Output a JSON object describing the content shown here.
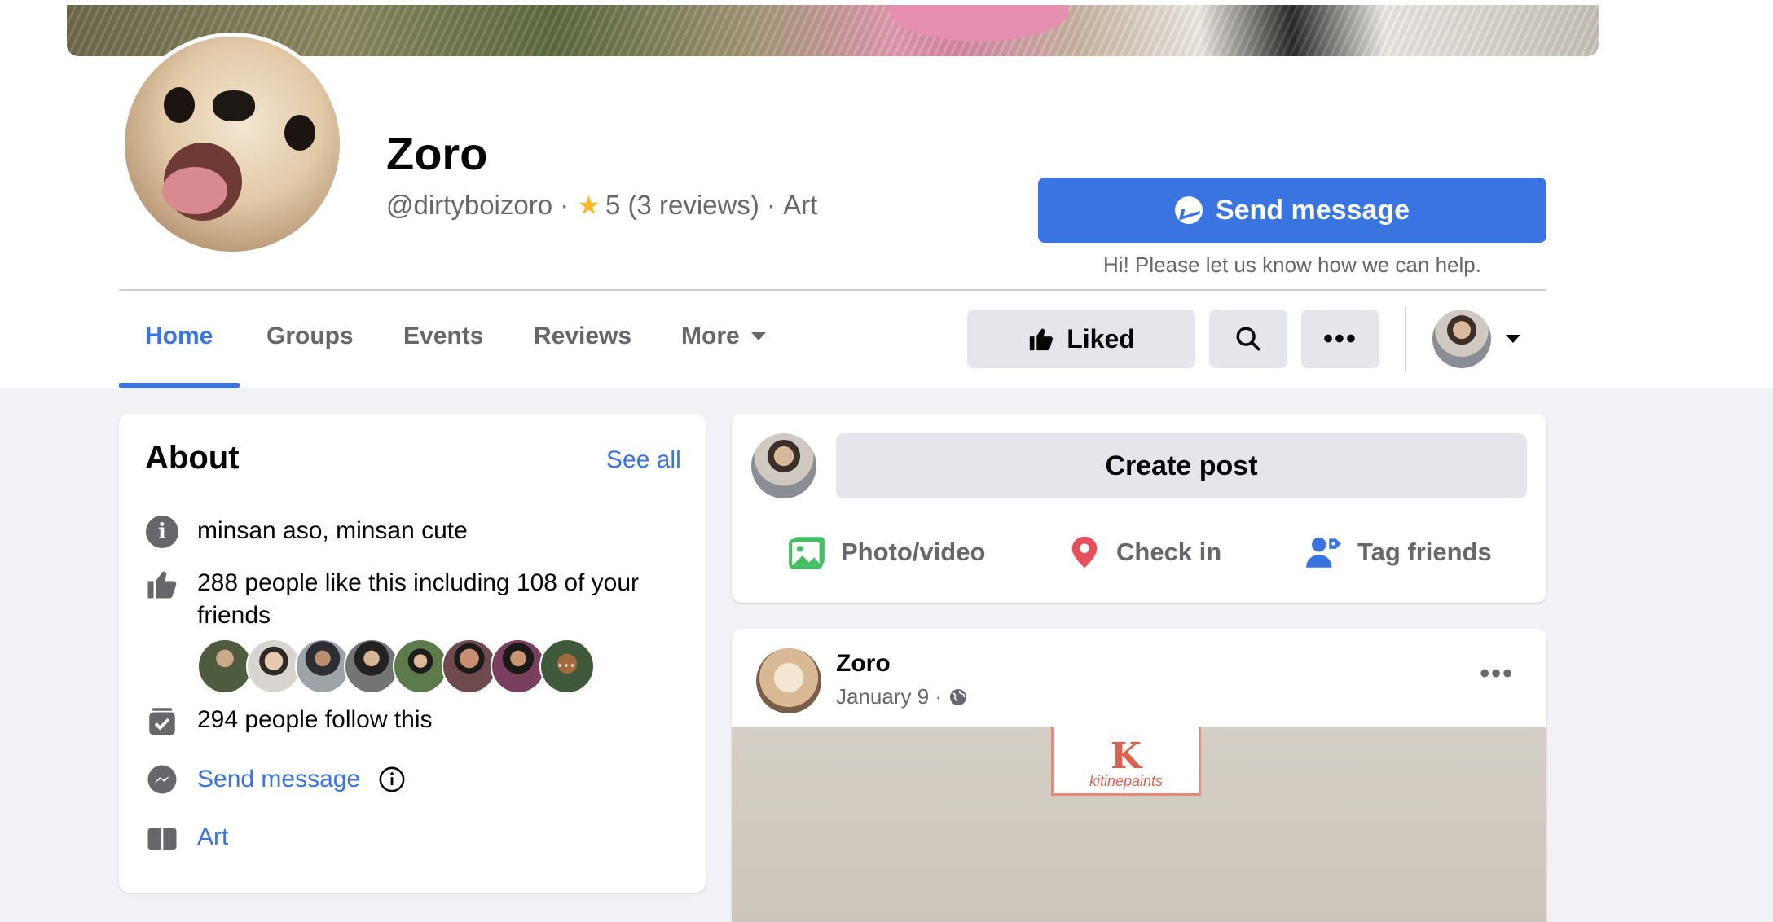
{
  "page": {
    "name": "Zoro",
    "username": "@dirtyboizoro",
    "rating": "5",
    "reviews": "(3 reviews)",
    "category": "Art"
  },
  "actions": {
    "send_message": "Send message",
    "send_hint": "Hi! Please let us know how we can help.",
    "liked": "Liked",
    "more_dots": "•••"
  },
  "tabs": [
    {
      "label": "Home",
      "active": true
    },
    {
      "label": "Groups"
    },
    {
      "label": "Events"
    },
    {
      "label": "Reviews"
    },
    {
      "label": "More"
    }
  ],
  "about": {
    "title": "About",
    "see_all": "See all",
    "description": "minsan aso, minsan cute",
    "likes": "288 people like this including 108 of your friends",
    "follows": "294 people follow this",
    "send_message": "Send message",
    "category": "Art"
  },
  "composer": {
    "create_post": "Create post",
    "photo_video": "Photo/video",
    "check_in": "Check in",
    "tag_friends": "Tag friends"
  },
  "post": {
    "author": "Zoro",
    "date": "January 9 ·",
    "more": "•••",
    "image_brand": "kitinepaints",
    "image_logo_letter": "K"
  },
  "colors": {
    "accent": "#3a74e0",
    "star": "#f7b928",
    "background": "#f0f2f5"
  }
}
